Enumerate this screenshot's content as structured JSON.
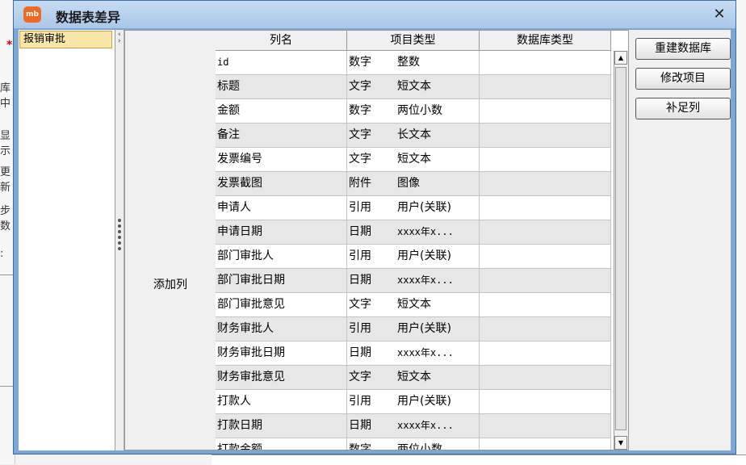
{
  "background": {
    "fragments": [
      "库中",
      "显示",
      "更新",
      "步数",
      ":"
    ]
  },
  "dialog": {
    "icon_text": "mb",
    "title": "数据表差异",
    "close": "✕"
  },
  "left_list": {
    "items": [
      "报销审批"
    ]
  },
  "grid": {
    "group_label": "添加列",
    "headers": [
      "列名",
      "项目类型",
      "数据库类型"
    ],
    "rows": [
      {
        "name": "id",
        "kind": "数字",
        "sub": "整数",
        "db": ""
      },
      {
        "name": "标题",
        "kind": "文字",
        "sub": "短文本",
        "db": ""
      },
      {
        "name": "金额",
        "kind": "数字",
        "sub": "两位小数",
        "db": ""
      },
      {
        "name": "备注",
        "kind": "文字",
        "sub": "长文本",
        "db": ""
      },
      {
        "name": "发票编号",
        "kind": "文字",
        "sub": "短文本",
        "db": ""
      },
      {
        "name": "发票截图",
        "kind": "附件",
        "sub": "图像",
        "db": ""
      },
      {
        "name": "申请人",
        "kind": "引用",
        "sub": "用户(关联)",
        "db": ""
      },
      {
        "name": "申请日期",
        "kind": "日期",
        "sub": "xxxx年x...",
        "db": ""
      },
      {
        "name": "部门审批人",
        "kind": "引用",
        "sub": "用户(关联)",
        "db": ""
      },
      {
        "name": "部门审批日期",
        "kind": "日期",
        "sub": "xxxx年x...",
        "db": ""
      },
      {
        "name": "部门审批意见",
        "kind": "文字",
        "sub": "短文本",
        "db": ""
      },
      {
        "name": "财务审批人",
        "kind": "引用",
        "sub": "用户(关联)",
        "db": ""
      },
      {
        "name": "财务审批日期",
        "kind": "日期",
        "sub": "xxxx年x...",
        "db": ""
      },
      {
        "name": "财务审批意见",
        "kind": "文字",
        "sub": "短文本",
        "db": ""
      },
      {
        "name": "打款人",
        "kind": "引用",
        "sub": "用户(关联)",
        "db": ""
      },
      {
        "name": "打款日期",
        "kind": "日期",
        "sub": "xxxx年x...",
        "db": ""
      },
      {
        "name": "打款金额",
        "kind": "数字",
        "sub": "两位小数",
        "db": ""
      }
    ]
  },
  "buttons": {
    "rebuild": "重建数据库",
    "modify": "修改项目",
    "fill": "补足列"
  },
  "scroll": {
    "up": "▲",
    "down": "▼"
  }
}
